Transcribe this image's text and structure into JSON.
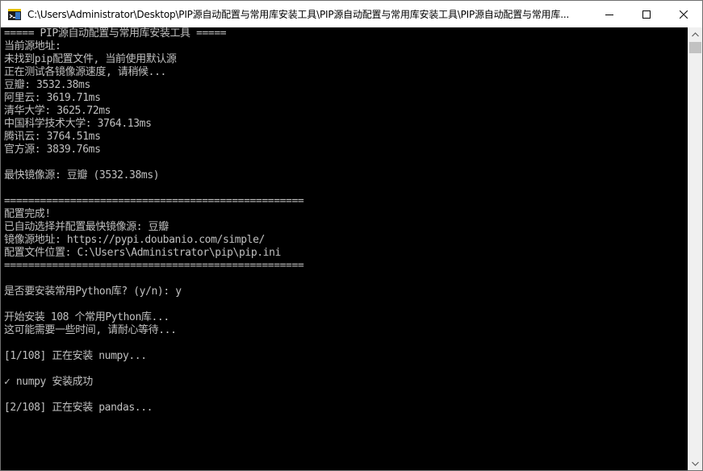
{
  "window": {
    "title": "C:\\Users\\Administrator\\Desktop\\PIP源自动配置与常用库安装工具\\PIP源自动配置与常用库安装工具\\PIP源自动配置与常用库..."
  },
  "console": {
    "lines": [
      "===== PIP源自动配置与常用库安装工具 =====",
      "当前源地址:",
      "未找到pip配置文件, 当前使用默认源",
      "正在测试各镜像源速度, 请稍候...",
      "豆瓣: 3532.38ms",
      "阿里云: 3619.71ms",
      "清华大学: 3625.72ms",
      "中国科学技术大学: 3764.13ms",
      "腾讯云: 3764.51ms",
      "官方源: 3839.76ms",
      "",
      "最快镜像源: 豆瓣 (3532.38ms)",
      "",
      "==================================================",
      "配置完成!",
      "已自动选择并配置最快镜像源: 豆瓣",
      "镜像源地址: https://pypi.doubanio.com/simple/",
      "配置文件位置: C:\\Users\\Administrator\\pip\\pip.ini",
      "==================================================",
      "",
      "是否要安装常用Python库? (y/n): y",
      "",
      "开始安装 108 个常用Python库...",
      "这可能需要一些时间, 请耐心等待...",
      "",
      "[1/108] 正在安装 numpy...",
      "",
      "✓ numpy 安装成功",
      "",
      "[2/108] 正在安装 pandas..."
    ]
  },
  "colors": {
    "console_bg": "#000000",
    "console_fg": "#c0c0c0",
    "titlebar_bg": "#ffffff",
    "scrollbar_bg": "#f0f0f0",
    "scrollbar_thumb": "#c2c2c2"
  },
  "icons": {
    "app": "console-app-icon",
    "minimize": "minimize-icon",
    "maximize": "maximize-icon",
    "close": "close-icon",
    "scroll_up": "scroll-up-arrow-icon",
    "scroll_down": "scroll-down-arrow-icon"
  }
}
